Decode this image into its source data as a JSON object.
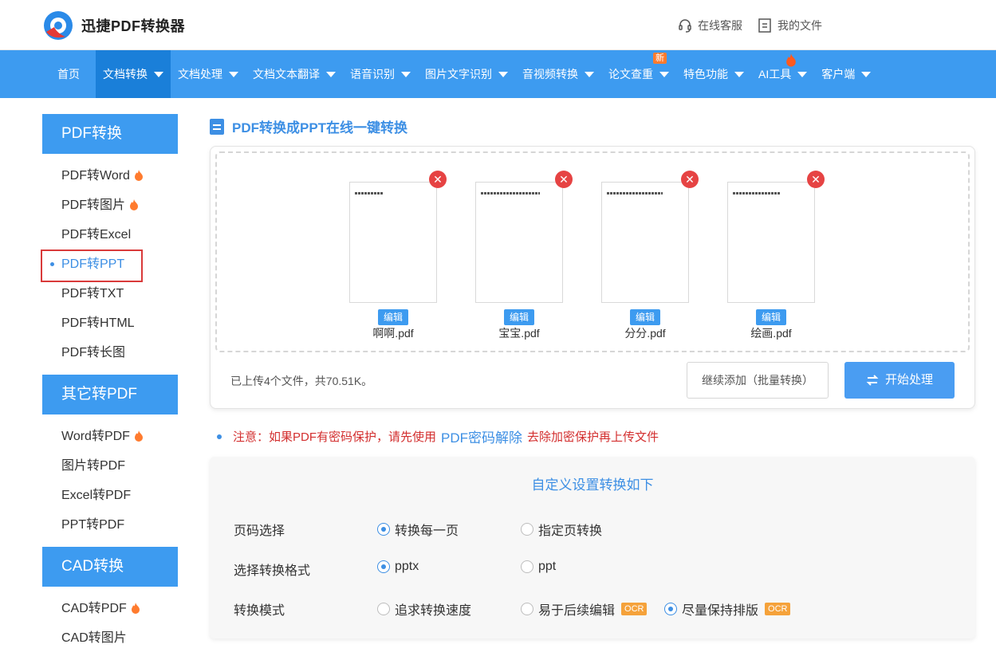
{
  "brand": {
    "name": "迅捷PDF转换器"
  },
  "top_links": [
    {
      "label": "在线客服",
      "icon": "headset-icon"
    },
    {
      "label": "我的文件",
      "icon": "file-icon"
    }
  ],
  "nav": {
    "items": [
      {
        "label": "首页"
      },
      {
        "label": "文档转换",
        "active": true
      },
      {
        "label": "文档处理"
      },
      {
        "label": "文档文本翻译"
      },
      {
        "label": "语音识别"
      },
      {
        "label": "图片文字识别"
      },
      {
        "label": "音视频转换"
      },
      {
        "label": "论文查重",
        "badge": "新"
      },
      {
        "label": "特色功能"
      },
      {
        "label": "AI工具",
        "hot": true
      },
      {
        "label": "客户端"
      }
    ]
  },
  "sidebar": {
    "groups": [
      {
        "title": "PDF转换",
        "items": [
          {
            "label": "PDF转Word",
            "hot": true
          },
          {
            "label": "PDF转图片",
            "hot": true
          },
          {
            "label": "PDF转Excel"
          },
          {
            "label": "PDF转PPT",
            "active": true
          },
          {
            "label": "PDF转TXT"
          },
          {
            "label": "PDF转HTML"
          },
          {
            "label": "PDF转长图"
          }
        ]
      },
      {
        "title": "其它转PDF",
        "items": [
          {
            "label": "Word转PDF",
            "hot": true
          },
          {
            "label": "图片转PDF"
          },
          {
            "label": "Excel转PDF"
          },
          {
            "label": "PPT转PDF"
          }
        ]
      },
      {
        "title": "CAD转换",
        "items": [
          {
            "label": "CAD转PDF",
            "hot": true
          },
          {
            "label": "CAD转图片"
          }
        ]
      }
    ]
  },
  "main": {
    "title": "PDF转换成PPT在线一键转换",
    "files": [
      {
        "name": "啊啊.pdf",
        "edit_label": "编辑"
      },
      {
        "name": "宝宝.pdf",
        "edit_label": "编辑"
      },
      {
        "name": "分分.pdf",
        "edit_label": "编辑"
      },
      {
        "name": "绘画.pdf",
        "edit_label": "编辑"
      }
    ],
    "upload_status": "已上传4个文件，共70.51K。",
    "add_more_label": "继续添加（批量转换）",
    "start_label": "开始处理",
    "notice": {
      "prefix": "注意：如果PDF有密码保护，请先使用",
      "link": "PDF密码解除",
      "suffix": "去除加密保护再上传文件"
    },
    "settings": {
      "title": "自定义设置转换如下",
      "rows": [
        {
          "label": "页码选择",
          "options": [
            {
              "label": "转换每一页",
              "checked": true
            },
            {
              "label": "指定页转换",
              "checked": false
            }
          ]
        },
        {
          "label": "选择转换格式",
          "options": [
            {
              "label": "pptx",
              "checked": true
            },
            {
              "label": "ppt",
              "checked": false
            }
          ]
        },
        {
          "label": "转换模式",
          "options": [
            {
              "label": "追求转换速度",
              "checked": false
            },
            {
              "label": "易于后续编辑",
              "checked": false,
              "tag": "OCR"
            },
            {
              "label": "尽量保持排版",
              "checked": true,
              "tag": "OCR"
            }
          ]
        }
      ]
    }
  },
  "colors": {
    "primary": "#3d9bf0",
    "active_nav": "#1a7fd9",
    "danger": "#e64343",
    "notice": "#d32f2f",
    "ocr_tag": "#f5a23a"
  }
}
